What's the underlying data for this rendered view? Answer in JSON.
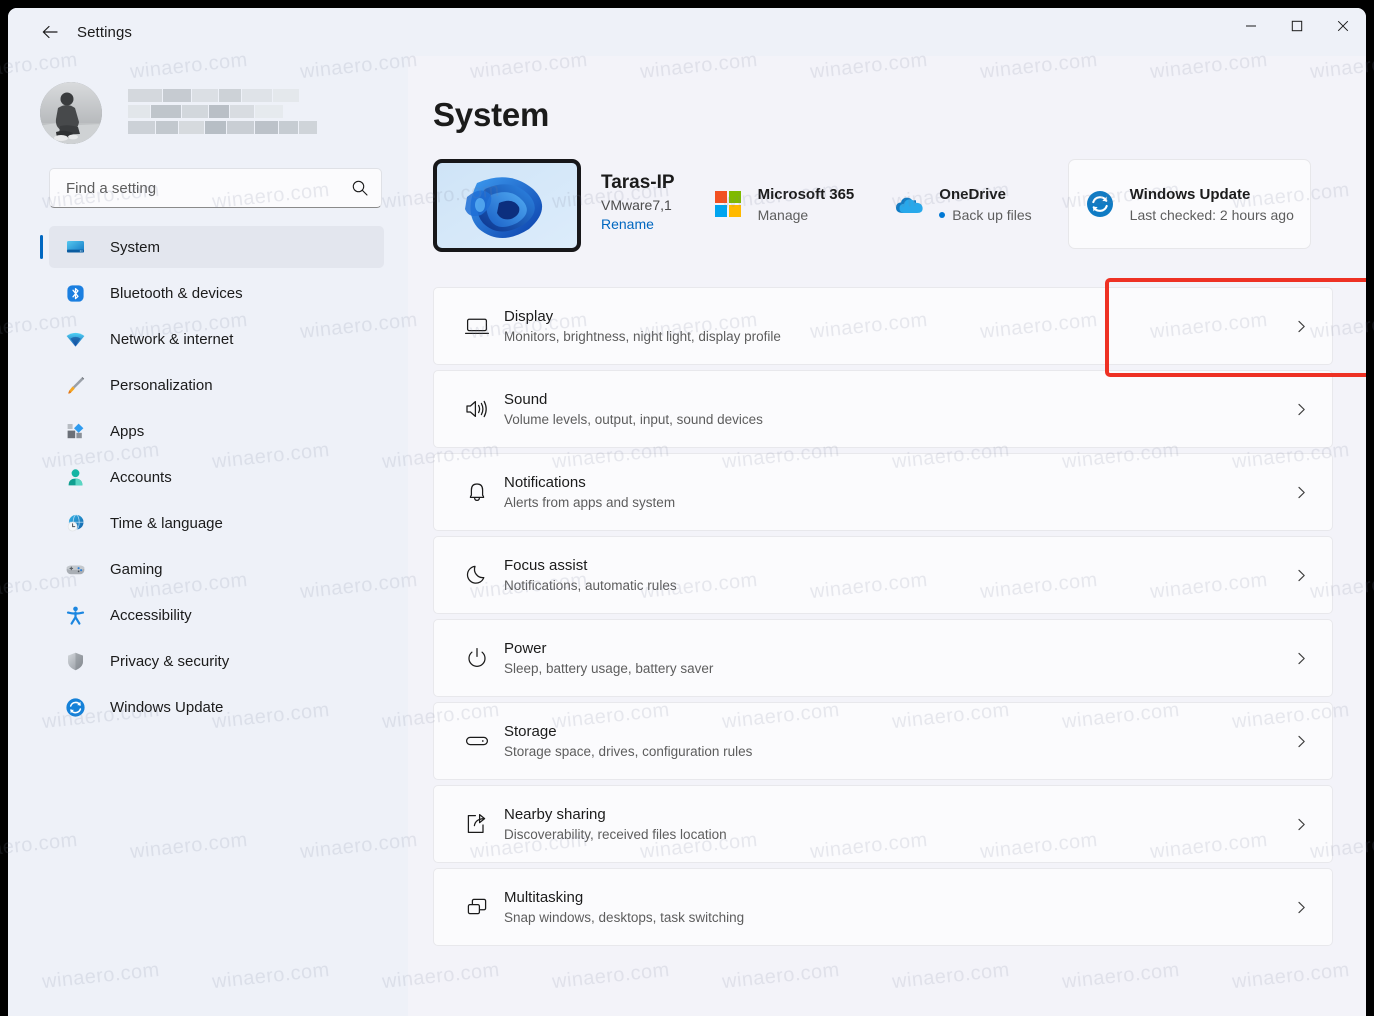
{
  "window": {
    "title": "Settings",
    "back_icon": "back-arrow-icon",
    "minimize_label": "—",
    "maximize_label": "□",
    "close_label": "✕"
  },
  "sidebar": {
    "account": {
      "avatar_icon": "user-avatar-photo",
      "name_redacted": ""
    },
    "search": {
      "placeholder": "Find a setting",
      "value": "",
      "icon": "search-icon"
    },
    "items": [
      {
        "label": "System",
        "icon": "system-monitor-icon",
        "active": true
      },
      {
        "label": "Bluetooth & devices",
        "icon": "bluetooth-icon",
        "active": false
      },
      {
        "label": "Network & internet",
        "icon": "wifi-icon",
        "active": false
      },
      {
        "label": "Personalization",
        "icon": "paintbrush-icon",
        "active": false
      },
      {
        "label": "Apps",
        "icon": "apps-icon",
        "active": false
      },
      {
        "label": "Accounts",
        "icon": "person-icon",
        "active": false
      },
      {
        "label": "Time & language",
        "icon": "clock-globe-icon",
        "active": false
      },
      {
        "label": "Gaming",
        "icon": "gamepad-icon",
        "active": false
      },
      {
        "label": "Accessibility",
        "icon": "accessibility-icon",
        "active": false
      },
      {
        "label": "Privacy & security",
        "icon": "shield-icon",
        "active": false
      },
      {
        "label": "Windows Update",
        "icon": "windows-update-icon",
        "active": false
      }
    ]
  },
  "main": {
    "page_title": "System",
    "device": {
      "name": "Taras-IP",
      "model": "VMware7,1",
      "rename_label": "Rename",
      "thumb_icon": "device-wallpaper-thumbnail"
    },
    "quick_cards": [
      {
        "id": "microsoft-365",
        "title": "Microsoft 365",
        "sub": "Manage",
        "icon": "microsoft-logo-icon",
        "has_dot": false,
        "highlighted": false
      },
      {
        "id": "onedrive",
        "title": "OneDrive",
        "sub": "Back up files",
        "icon": "onedrive-cloud-icon",
        "has_dot": true,
        "highlighted": false
      },
      {
        "id": "windows-update",
        "title": "Windows Update",
        "sub": "Last checked: 2 hours ago",
        "icon": "windows-update-refresh-icon",
        "has_dot": false,
        "highlighted": true
      }
    ],
    "settings_rows": [
      {
        "title": "Display",
        "sub": "Monitors, brightness, night light, display profile",
        "icon": "monitor-icon"
      },
      {
        "title": "Sound",
        "sub": "Volume levels, output, input, sound devices",
        "icon": "speaker-icon"
      },
      {
        "title": "Notifications",
        "sub": "Alerts from apps and system",
        "icon": "bell-icon"
      },
      {
        "title": "Focus assist",
        "sub": "Notifications, automatic rules",
        "icon": "moon-icon"
      },
      {
        "title": "Power",
        "sub": "Sleep, battery usage, battery saver",
        "icon": "power-icon"
      },
      {
        "title": "Storage",
        "sub": "Storage space, drives, configuration rules",
        "icon": "drive-icon"
      },
      {
        "title": "Nearby sharing",
        "sub": "Discoverability, received files location",
        "icon": "share-icon"
      },
      {
        "title": "Multitasking",
        "sub": "Snap windows, desktops, task switching",
        "icon": "windows-stack-icon"
      }
    ],
    "chevron_icon": "chevron-right-icon"
  },
  "watermark": {
    "text": "winaero.com"
  },
  "colors": {
    "accent": "#0067c0",
    "highlight_box": "#ee3124",
    "page_bg": "#f3f3f9",
    "sidebar_bg": "#eef1f8",
    "card_bg": "#fbfbfd"
  }
}
